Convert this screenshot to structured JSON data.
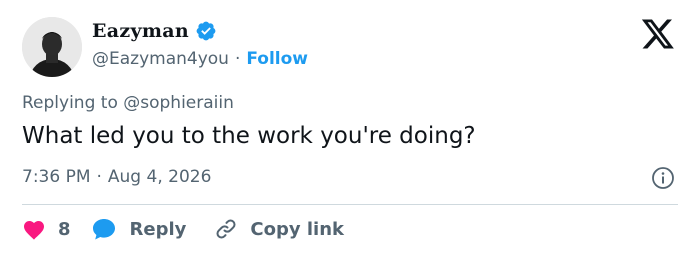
{
  "author": {
    "display_name": "Eazyman",
    "handle": "@Eazyman4you",
    "separator": "·",
    "follow_label": "Follow",
    "verified_color": "#1d9bf0"
  },
  "reply_context": {
    "prefix": "Replying to",
    "target": "@sophieraiin"
  },
  "tweet": {
    "text": "What led you to the work you're doing?",
    "time": "7:36 PM",
    "separator": "·",
    "date": "Aug 4, 2026"
  },
  "actions": {
    "like_count": "8",
    "reply_label": "Reply",
    "copy_label": "Copy link",
    "like_color": "#f91880",
    "reply_color": "#1d9bf0"
  },
  "icons": [
    "verified-badge-icon",
    "x-logo-icon",
    "info-icon",
    "heart-icon",
    "reply-bubble-icon",
    "link-icon"
  ]
}
